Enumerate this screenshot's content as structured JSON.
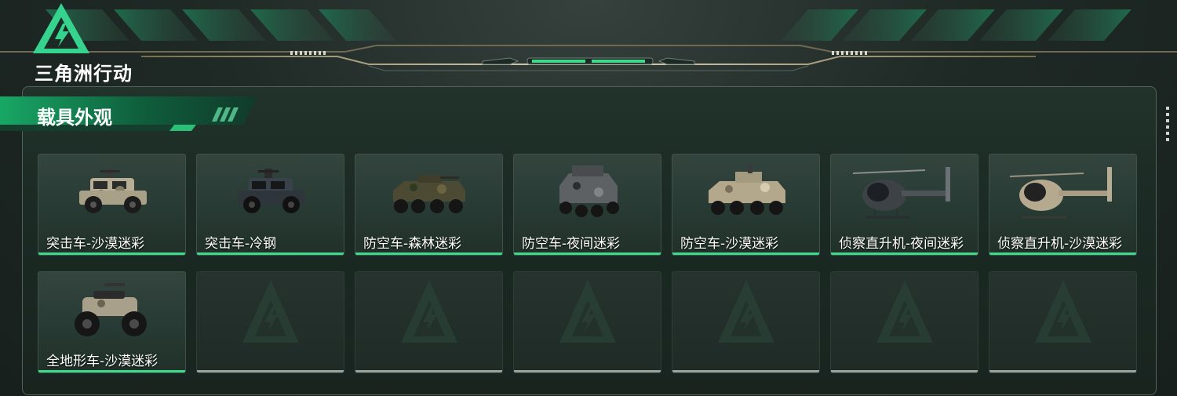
{
  "app": {
    "logo_text": "三角洲行动",
    "accent_color": "#3fd98a"
  },
  "section": {
    "title": "载具外观"
  },
  "vehicles": [
    {
      "name": "突击车-沙漠迷彩",
      "type": "assault-vehicle",
      "camo": "desert"
    },
    {
      "name": "突击车-冷钢",
      "type": "assault-vehicle",
      "camo": "cold-steel"
    },
    {
      "name": "防空车-森林迷彩",
      "type": "aa-vehicle",
      "camo": "forest"
    },
    {
      "name": "防空车-夜间迷彩",
      "type": "aa-vehicle",
      "camo": "night"
    },
    {
      "name": "防空车-沙漠迷彩",
      "type": "aa-vehicle",
      "camo": "desert"
    },
    {
      "name": "侦察直升机-夜间迷彩",
      "type": "scout-helicopter",
      "camo": "night"
    },
    {
      "name": "侦察直升机-沙漠迷彩",
      "type": "scout-helicopter",
      "camo": "desert"
    },
    {
      "name": "全地形车-沙漠迷彩",
      "type": "atv",
      "camo": "desert"
    }
  ],
  "empty_slots": 6
}
